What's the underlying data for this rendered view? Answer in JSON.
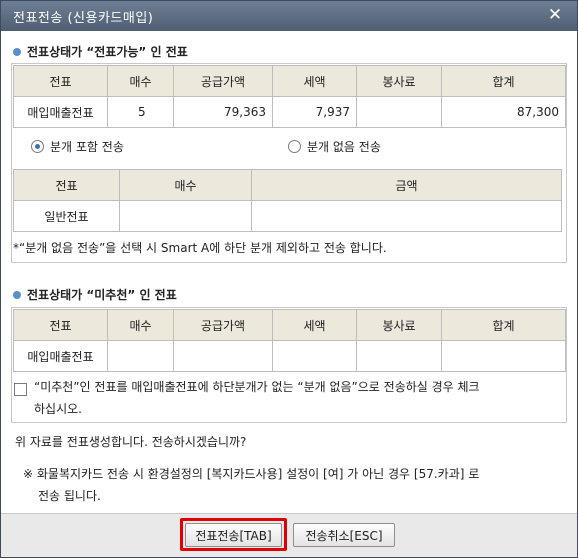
{
  "window": {
    "title": "전표전송 (신용카드매입)"
  },
  "section1": {
    "title": "전표상태가 “전표가능” 인 전표",
    "table": {
      "headers": [
        "전표",
        "매수",
        "공급가액",
        "세액",
        "봉사료",
        "합계"
      ],
      "row": [
        "매입매출전표",
        "5",
        "79,363",
        "7,937",
        "",
        "87,300"
      ]
    },
    "radio_include": "분개 포함 전송",
    "radio_exclude": "분개 없음 전송",
    "subtable": {
      "headers": [
        "전표",
        "매수",
        "금액"
      ],
      "row": [
        "일반전표",
        "",
        ""
      ]
    },
    "note": "*“분개 없음 전송”을 선택 시 Smart A에 하단 분개 제외하고 전송 합니다."
  },
  "section2": {
    "title": "전표상태가 “미추천” 인 전표",
    "table": {
      "headers": [
        "전표",
        "매수",
        "공급가액",
        "세액",
        "봉사료",
        "합계"
      ],
      "row": [
        "매입매출전표",
        "",
        "",
        "",
        "",
        ""
      ]
    },
    "checkbox_line1": "“미추천”인 전표를 매입매출전표에 하단분개가 없는 “분개 없음”으로 전송하실 경우 체크",
    "checkbox_line2": "하십시오."
  },
  "confirm": "위 자료를 전표생성합니다. 전송하시겠습니까?",
  "info_line1": "※ 화물복지카드 전송 시 환경설정의 [복지카드사용] 설정이 [여] 가 아닌 경우 [57.카과] 로",
  "info_line2": "전송 됩니다.",
  "buttons": {
    "send": "전표전송[TAB]",
    "cancel": "전송취소[ESC]"
  }
}
